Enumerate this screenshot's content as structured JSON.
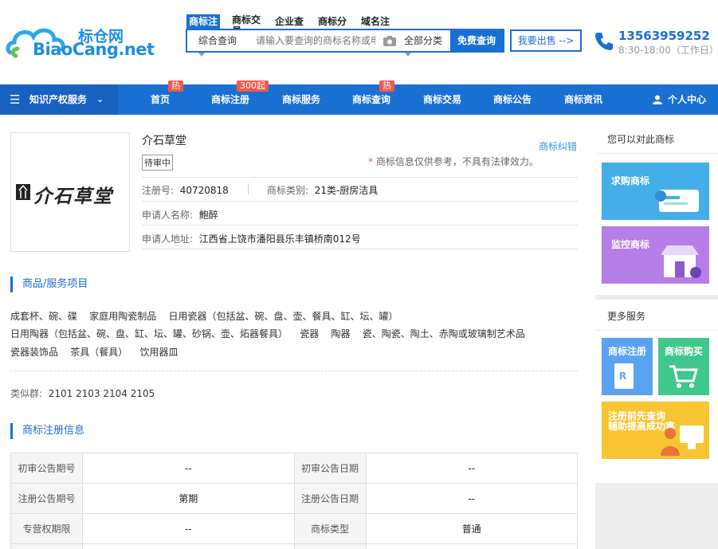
{
  "header": {
    "logo_cn": "标仓网",
    "logo_en": "BiaoCang.net",
    "search_tabs": [
      "商标注",
      "商标交易",
      "企业查",
      "商标分",
      "域名注"
    ],
    "search_scope": "综合查询",
    "search_placeholder": "请输入要查询的商标名称或申",
    "search_category": "全部分类",
    "search_button": "免费查询",
    "sell_button": "我要出售 -->",
    "phone": "13563959252",
    "hours": "8:30-18:00（工作日）"
  },
  "nav": {
    "category_label": "知识产权服务",
    "items": [
      {
        "label": "首页",
        "badge": "热"
      },
      {
        "label": "商标注册",
        "badge": "300起"
      },
      {
        "label": "商标服务",
        "badge": ""
      },
      {
        "label": "商标查询",
        "badge": "热"
      },
      {
        "label": "商标交易",
        "badge": ""
      },
      {
        "label": "商标公告",
        "badge": ""
      },
      {
        "label": "商标资讯",
        "badge": ""
      }
    ],
    "user_center": "个人中心"
  },
  "trademark": {
    "logo_text": "介石草堂",
    "name": "介石草堂",
    "status": "待审中",
    "correct_link": "商标纠错",
    "disclaimer": "商标信息仅供参考，不具有法律效力。",
    "reg_no_label": "注册号:",
    "reg_no": "40720818",
    "class_label": "商标类别:",
    "class_value": "21类-厨房洁具",
    "applicant_label": "申请人名称:",
    "applicant": "鲍醉",
    "address_label": "申请人地址:",
    "address": "江西省上饶市潘阳县乐丰镇桥南012号"
  },
  "goods": {
    "title": "商品/服务项目",
    "lines": [
      "成套杯、碗、碟    家庭用陶瓷制品    日用瓷器（包括盆、碗、盘、壶、餐具、缸、坛、罐）",
      "日用陶器（包括盆、碗、盘、缸、坛、罐、砂锅、壶、炻器餐具）    瓷器    陶器    瓷、陶瓷、陶土、赤陶或玻璃制艺术品",
      "瓷器装饰品    茶具（餐具）    饮用器皿"
    ],
    "similar_label": "类似群:",
    "similar_value": "2101 2103 2104 2105"
  },
  "registration": {
    "title": "商标注册信息",
    "rows": [
      [
        "初审公告期号",
        "--",
        "初审公告日期",
        "--"
      ],
      [
        "注册公告期号",
        "第期",
        "注册公告日期",
        "--"
      ],
      [
        "专营权期限",
        "--",
        "商标类型",
        "普通"
      ]
    ]
  },
  "sidebar": {
    "title": "您可以对此商标",
    "cards": [
      "求购商标",
      "监控商标"
    ],
    "more_title": "更多服务",
    "small_cards": [
      "商标注册",
      "商标购买"
    ],
    "wide_card": [
      "注册前先查询",
      "辅助提高成功率"
    ]
  },
  "colors": {
    "primary": "#1a6fd2",
    "badge": "#f05a4a"
  }
}
